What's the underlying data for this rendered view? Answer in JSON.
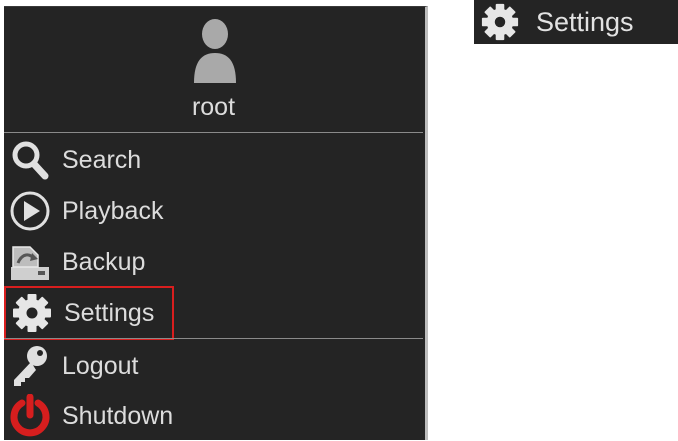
{
  "user": {
    "name": "root",
    "avatar_icon": "user-avatar-icon"
  },
  "menu": {
    "items": [
      {
        "label": "Search",
        "icon": "search-icon"
      },
      {
        "label": "Playback",
        "icon": "playback-icon"
      },
      {
        "label": "Backup",
        "icon": "backup-icon"
      },
      {
        "label": "Settings",
        "icon": "gear-icon",
        "selected": true
      },
      {
        "label": "Logout",
        "icon": "key-icon"
      },
      {
        "label": "Shutdown",
        "icon": "power-icon"
      }
    ]
  },
  "zoom_badge": {
    "label": "Settings",
    "icon": "gear-icon"
  },
  "colors": {
    "panel_bg": "#242424",
    "text": "#dcdcdc",
    "selection_outline": "#d91e1e",
    "power_red": "#d61e1e"
  }
}
